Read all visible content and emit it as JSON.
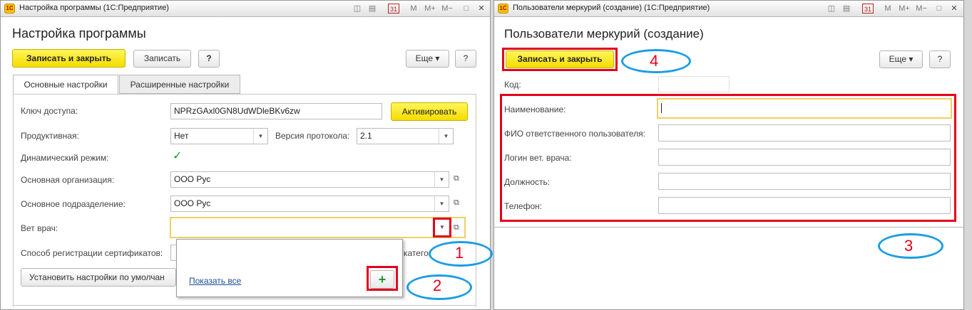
{
  "left_window": {
    "title": "Настройка программы  (1С:Предприятие)",
    "toolbar_icons": [
      "◫",
      "▤",
      "31",
      "M",
      "M+",
      "M−",
      "□",
      "✕"
    ],
    "heading": "Настройка программы",
    "buttons": {
      "save_close": "Записать и закрыть",
      "save": "Записать",
      "help": "?",
      "more": "Еще ▾",
      "help2": "?"
    },
    "tabs": [
      "Основные настройки",
      "Расширенные настройки"
    ],
    "fields": {
      "access_key_label": "Ключ доступа:",
      "access_key_value": "NPRzGAxl0GN8UdWDleBKv6zw",
      "activate": "Активировать",
      "productive_label": "Продуктивная:",
      "productive_value": "Нет",
      "protocol_label": "Версия протокола:",
      "protocol_value": "2.1",
      "dynamic_label": "Динамический режим:",
      "org_label": "Основная организация:",
      "org_value": "ООО Рус",
      "division_label": "Основное подразделение:",
      "division_value": "ООО Рус",
      "vet_label": "Вет врач:",
      "vet_value": "",
      "cert_label": "Способ регистрации сертификатов:",
      "cert_suffix": "катего",
      "defaults_button": "Установить настройки по умолчан"
    },
    "popup": {
      "show_all": "Показать все",
      "add": "+"
    }
  },
  "right_window": {
    "title": "Пользователи меркурий (создание)  (1С:Предприятие)",
    "toolbar_icons": [
      "◫",
      "▤",
      "31",
      "M",
      "M+",
      "M−",
      "□",
      "✕"
    ],
    "heading": "Пользователи меркурий (создание)",
    "buttons": {
      "save_close": "Записать и закрыть",
      "more": "Еще ▾",
      "help": "?"
    },
    "fields": {
      "code_label": "Код:",
      "name_label": "Наименование:",
      "fio_label": "ФИО ответственного пользователя:",
      "login_label": "Логин вет. врача:",
      "position_label": "Должность:",
      "phone_label": "Телефон:"
    }
  },
  "annotations": [
    "1",
    "2",
    "3",
    "4"
  ],
  "colors": {
    "highlight_red": "#e3001b",
    "ellipse_blue": "#1b9ee0",
    "button_yellow": "#f5dc00"
  }
}
